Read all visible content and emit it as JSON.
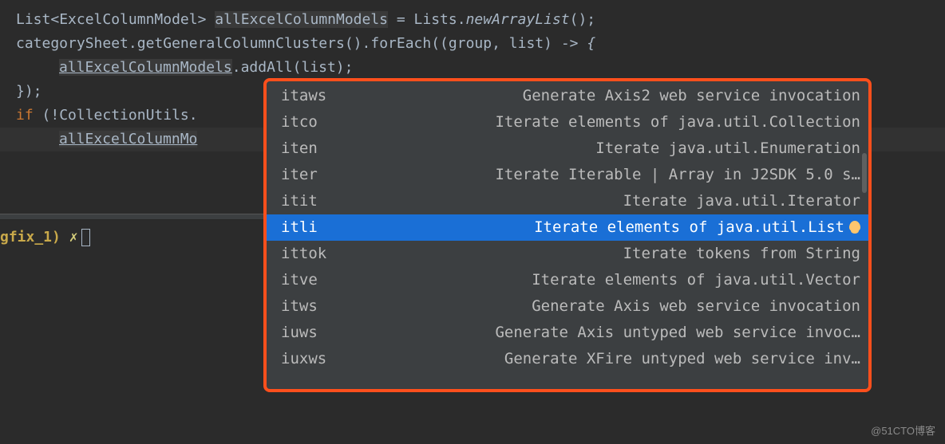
{
  "code": {
    "l1": {
      "type1": "List",
      "lt": "<",
      "gparam": "ExcelColumnModel",
      "gt": ">",
      "sp": " ",
      "var": "allExcelColumnModels",
      "eq": " = ",
      "cls": "Lists",
      "dot": ".",
      "mth": "newArrayList",
      "end": "();"
    },
    "l2": {
      "a": "categorySheet",
      "d1": ".",
      "m1": "getGeneralColumnClusters",
      "p1": "()",
      "d2": ".",
      "m2": "forEach",
      "p2": "((",
      "g": "group",
      "c": ", ",
      "li": "list",
      "p3": ") -> ",
      "brace": "{"
    },
    "l3": {
      "v": "allExcelColumnModels",
      "d": ".",
      "m": "addAll",
      "p": "(list);"
    },
    "l4": {
      "t": "});"
    },
    "l5": {
      "if": "if",
      "sp": " (!",
      "cls": "CollectionUtils",
      "dot": "."
    },
    "l6": {
      "t": "allExcelColumnMo"
    }
  },
  "popup": {
    "items": [
      {
        "abbr": "itaws",
        "desc": "Generate Axis2 web service invocation"
      },
      {
        "abbr": "itco",
        "desc": "Iterate elements of java.util.Collection"
      },
      {
        "abbr": "iten",
        "desc": "Iterate java.util.Enumeration"
      },
      {
        "abbr": "iter",
        "desc": "Iterate Iterable | Array in J2SDK 5.0 s…"
      },
      {
        "abbr": "itit",
        "desc": "Iterate java.util.Iterator"
      },
      {
        "abbr": "itli",
        "desc": "Iterate elements of java.util.List",
        "selected": true,
        "bulb": true
      },
      {
        "abbr": "ittok",
        "desc": "Iterate tokens from String"
      },
      {
        "abbr": "itve",
        "desc": "Iterate elements of java.util.Vector"
      },
      {
        "abbr": "itws",
        "desc": "Generate Axis web service invocation"
      },
      {
        "abbr": "iuws",
        "desc": "Generate Axis untyped web service invoc…"
      },
      {
        "abbr": "iuxws",
        "desc": "Generate XFire untyped web service inv…"
      }
    ]
  },
  "terminal": {
    "prompt": "gfix_1)",
    "sep": " ",
    "x": "✗"
  },
  "watermark": "@51CTO博客"
}
